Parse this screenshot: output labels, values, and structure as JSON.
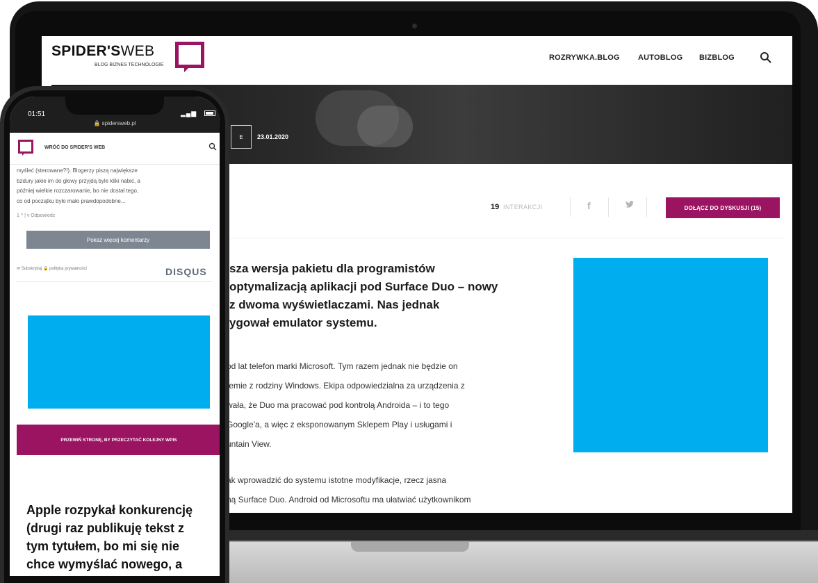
{
  "laptop": {
    "header": {
      "logo_main": "SPIDER'S",
      "logo_web": "WEB",
      "logo_tagline": "BLOG BIZNES TECHNOLOGIE",
      "nav": [
        "ROZRYWKA.BLOG",
        "AUTOBLOG",
        "BIZBLOG"
      ]
    },
    "hero": {
      "category": "E",
      "date": "23.01.2020"
    },
    "share": {
      "interactions_count": "19",
      "interactions_label": "INTERAKCJI",
      "facebook": "f",
      "twitter": "t",
      "join_label": "DOŁĄCZ DO DYSKUSJI (15)"
    },
    "lead_lines": [
      "sza wersja pakietu dla programistów",
      "optymalizacją aplikacji pod Surface Duo – nowy",
      "z dwoma wyświetlaczami. Nas jednak",
      "ygował emulator systemu."
    ],
    "paragraph1": [
      "od lat telefon marki Microsoft. Tym razem jednak nie będzie on",
      "temie z rodziny Windows. Ekipa odpowiedzialna za urządzenia z",
      "wała, że Duo ma pracować pod kontrolą Androida – i to tego",
      "Google'a, a więc z eksponowanym Sklepem Play i usługami i",
      "untain View."
    ],
    "paragraph2": [
      "ak wprowadzić do systemu istotne modyfikacje, rzecz jasna",
      "ną Surface Duo. Android od Microsoftu ma ułatwiać użytkownikom"
    ]
  },
  "phone": {
    "time": "01:51",
    "url": "spidersweb.pl",
    "back_label": "WRÓĆ DO SPIDER'S WEB",
    "comment_lines": [
      "myśleć (sterowane?!). Blogerzy piszą największe",
      "bzdury jakie im do głowy przyjdą byle kliki nabić, a",
      "później wielkie rozczarowanie, bo nie dostał tego,",
      "co od początku było mało prawdopodobne..."
    ],
    "vote_text": "1 ^ | v   Odpowiedz",
    "load_more": "Pokaż więcej komentarzy",
    "subscribe": "✉ Subskrybuj   🔒 polityka prywatności",
    "disqus": "DISQUS",
    "next_button": "PRZEWIŃ STRONĘ, BY PRZECZYTAĆ KOLEJNY WPIS",
    "next_title_lines": [
      "Apple rozpykał konkurencję",
      "(drugi raz publikuję tekst z",
      "tym tytułem, bo mi się nie",
      "chce wymyślać nowego, a"
    ]
  },
  "colors": {
    "brand": "#9b1461",
    "ad_placeholder": "#00adee",
    "load_more_bg": "#7e8791"
  }
}
